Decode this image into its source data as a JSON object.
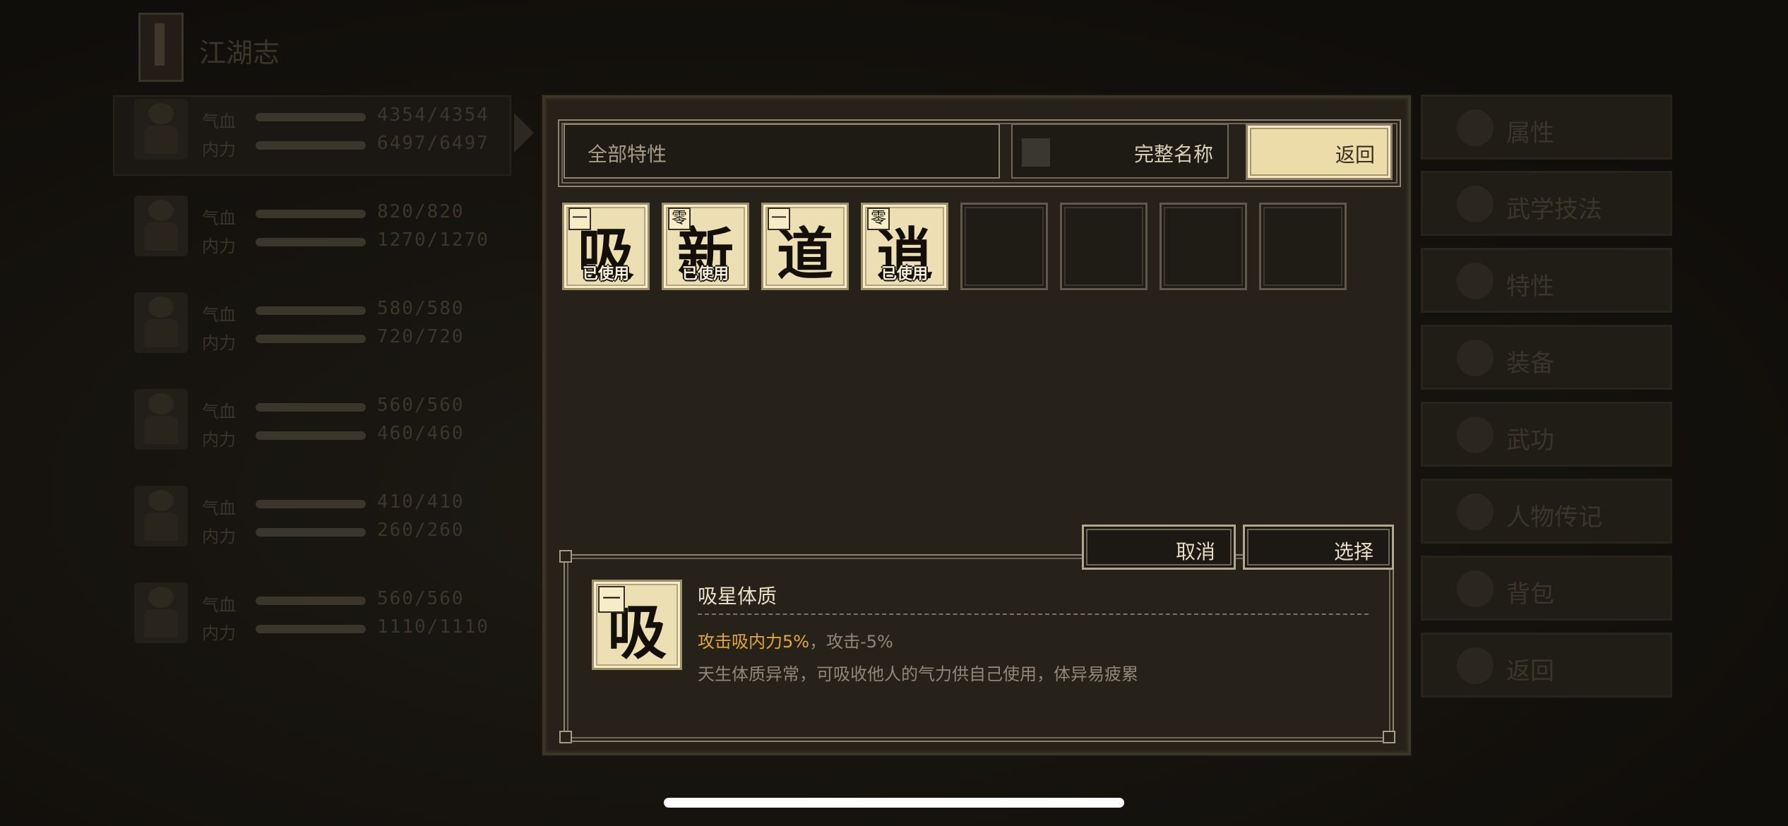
{
  "background": {
    "journal_title": "江湖志",
    "party": [
      {
        "hp_label": "气血",
        "hp": "4354/4354",
        "mp_label": "内力",
        "mp": "6497/6497"
      },
      {
        "hp_label": "气血",
        "hp": "820/820",
        "mp_label": "内力",
        "mp": "1270/1270"
      },
      {
        "hp_label": "气血",
        "hp": "580/580",
        "mp_label": "内力",
        "mp": "720/720"
      },
      {
        "hp_label": "气血",
        "hp": "560/560",
        "mp_label": "内力",
        "mp": "460/460"
      },
      {
        "hp_label": "气血",
        "hp": "410/410",
        "mp_label": "内力",
        "mp": "260/260"
      },
      {
        "hp_label": "气血",
        "hp": "560/560",
        "mp_label": "内力",
        "mp": "1110/1110"
      }
    ],
    "menu": [
      "属性",
      "武学技法",
      "特性",
      "装备",
      "武功",
      "人物传记",
      "背包",
      "返回"
    ]
  },
  "modal": {
    "filter_label": "全部特性",
    "full_name_label": "完整名称",
    "back_label": "返回",
    "cancel_label": "取消",
    "select_label": "选择",
    "cards": [
      {
        "grade": "一",
        "char": "吸",
        "status": "已使用"
      },
      {
        "grade": "零",
        "char": "新",
        "status": "已使用"
      },
      {
        "grade": "一",
        "char": "道",
        "status": ""
      },
      {
        "grade": "零",
        "char": "逍",
        "status": "已使用"
      }
    ],
    "detail": {
      "grade": "一",
      "char": "吸",
      "name": "吸星体质",
      "effect_positive": "攻击吸内力5%",
      "effect_sep": "，",
      "effect_negative": "攻击-5%",
      "description": "天生体质异常，可吸收他人的气力供自己使用，体异易疲累"
    }
  }
}
